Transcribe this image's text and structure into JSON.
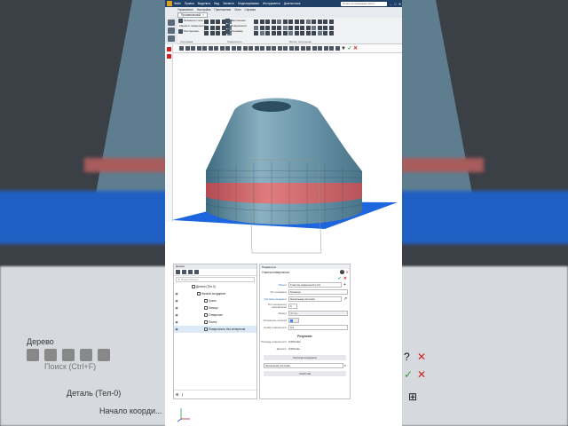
{
  "app": {
    "window_title": "",
    "menu": [
      "Файл",
      "Правка",
      "Выделить",
      "Вид",
      "Элемент",
      "Моделирование",
      "Инструменты",
      "Диагностика"
    ],
    "menu_row2": [
      "Управление",
      "Настройка",
      "Приложения",
      "Окно",
      "Справка"
    ],
    "search_placeholder": "Поиск по командам (Alt+/)",
    "active_tab": "Произвольный",
    "ribbon": {
      "side_buttons": [
        "Элементы тела",
        "Каркас и поверхности",
        "Построения"
      ],
      "group1": [
        "Вспомогательная геометрия",
        "Каркас и поверхности",
        "Кинематические"
      ],
      "caption1": "Системная",
      "group2": [
        "Заполнение",
        "Поверхности",
        "Тренажёр"
      ],
      "group3": [
        "Расширенное поверхностное"
      ],
      "caption2": "Поверхность",
      "caption3": "Вспом. построения"
    }
  },
  "tree_panel": {
    "title": "Дерево",
    "search_placeholder": "Поиск (Ctrl+F)",
    "rows": [
      {
        "label": "Деталь (Тел-0)",
        "level": 1
      },
      {
        "label": "Начало координат",
        "level": 2
      },
      {
        "label": "Грань",
        "level": 3
      },
      {
        "label": "Кольцо",
        "level": 3
      },
      {
        "label": "Отверстие",
        "level": 3
      },
      {
        "label": "Плита",
        "level": 3
      },
      {
        "label": "Поверхность без интересов",
        "level": 3
      }
    ]
  },
  "param_panel": {
    "title": "Параметры",
    "subtitle": "Участок поверхности",
    "fields": [
      {
        "label": "Объект",
        "value": "Участок поверхности (4)"
      },
      {
        "label": "Тип координат",
        "value": "Граница"
      },
      {
        "label": "Система координат",
        "value": "Начальная система"
      },
      {
        "label": "Угол начального направления",
        "value": "0"
      },
      {
        "label": "Радиус",
        "value": "30 мм"
      },
      {
        "label": "Положение опорной",
        "value": ""
      },
      {
        "label": "Номер поверхности",
        "value": "0,0"
      }
    ],
    "result_title": "Результат",
    "results": [
      {
        "label": "Площадь поверхности",
        "value": "0,000 мм²"
      },
      {
        "label": "Диаметр",
        "value": "0,000 мм"
      }
    ],
    "section_bar1": "Система координат",
    "coord_value": "Начальная система",
    "section_bar2": "Свойства"
  },
  "bg": {
    "tree_title": "Дерево",
    "tree_search": "Поиск (Ctrl+F)",
    "tree_row1": "Деталь (Тел-0)",
    "tree_row2": "Начало коорди..."
  },
  "colors": {
    "model": "#6a93a8",
    "band": "#c9646a",
    "floor": "#1d66e0",
    "title_bar": "#1f3f66"
  }
}
